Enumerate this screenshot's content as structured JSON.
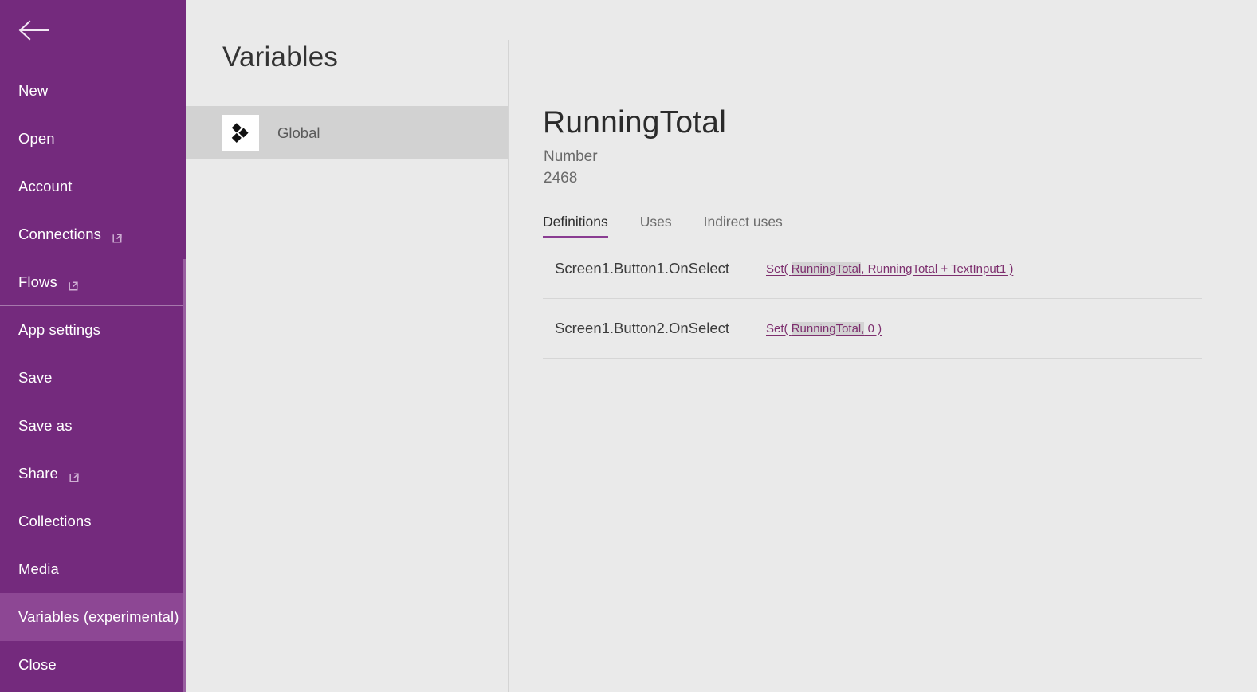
{
  "sidebar": {
    "back_icon": "back-arrow-icon",
    "accent_color": "#742a7d",
    "selected_color": "#8d4794",
    "items": [
      {
        "label": "New",
        "external": false,
        "selected": false,
        "divider_above": false
      },
      {
        "label": "Open",
        "external": false,
        "selected": false,
        "divider_above": false
      },
      {
        "label": "Account",
        "external": false,
        "selected": false,
        "divider_above": false
      },
      {
        "label": "Connections",
        "external": true,
        "selected": false,
        "divider_above": false
      },
      {
        "label": "Flows",
        "external": true,
        "selected": false,
        "divider_above": false
      },
      {
        "label": "App settings",
        "external": false,
        "selected": false,
        "divider_above": true
      },
      {
        "label": "Save",
        "external": false,
        "selected": false,
        "divider_above": false
      },
      {
        "label": "Save as",
        "external": false,
        "selected": false,
        "divider_above": false
      },
      {
        "label": "Share",
        "external": true,
        "selected": false,
        "divider_above": false
      },
      {
        "label": "Collections",
        "external": false,
        "selected": false,
        "divider_above": false
      },
      {
        "label": "Media",
        "external": false,
        "selected": false,
        "divider_above": false
      },
      {
        "label": "Variables (experimental)",
        "external": false,
        "selected": true,
        "divider_above": false
      },
      {
        "label": "Close",
        "external": false,
        "selected": false,
        "divider_above": false
      }
    ]
  },
  "variables_pane": {
    "title": "Variables",
    "items": [
      {
        "label": "Global",
        "icon": "diamonds-icon",
        "selected": true
      }
    ]
  },
  "detail": {
    "name": "RunningTotal",
    "type": "Number",
    "value": "2468",
    "tabs": [
      {
        "label": "Definitions",
        "active": true
      },
      {
        "label": "Uses",
        "active": false
      },
      {
        "label": "Indirect uses",
        "active": false
      }
    ],
    "accent_color": "#8a3d92",
    "link_color": "#7d2f6e",
    "definitions": [
      {
        "property": "Screen1.Button1.OnSelect",
        "formula_prefix": "Set( ",
        "formula_highlight": "RunningTotal",
        "formula_suffix": ", RunningTotal + TextInput1 )"
      },
      {
        "property": "Screen1.Button2.OnSelect",
        "formula_prefix": "Set( ",
        "formula_highlight": "RunningTotal,",
        "formula_suffix": " 0 )"
      }
    ]
  }
}
